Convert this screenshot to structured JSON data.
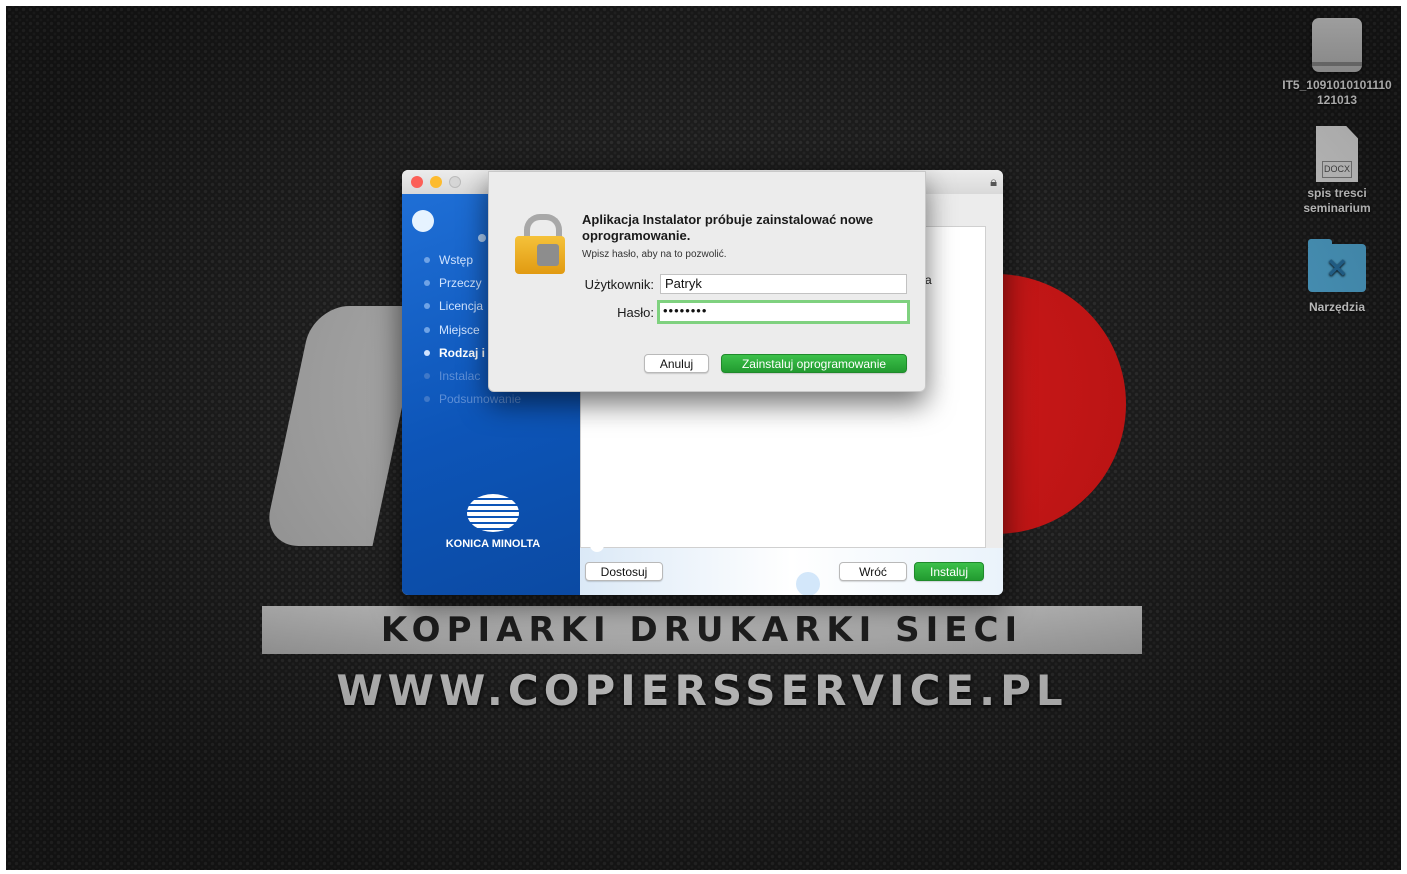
{
  "desktop": {
    "wallpaper": {
      "band_text": "KOPIARKI DRUKARKI SIECI",
      "url_text": "WWW.COPIERSSERVICE.PL"
    },
    "icons": [
      {
        "name": "IT5_1091010101110121013",
        "type": "drive-icon"
      },
      {
        "name": "spis tresci seminarium",
        "type": "docx-file-icon",
        "badge": "DOCX"
      },
      {
        "name": "Narzędzia",
        "type": "folder-icon"
      }
    ]
  },
  "installer": {
    "steps": [
      {
        "label": "Wstęp",
        "state": "done"
      },
      {
        "label": "Przeczy",
        "state": "done"
      },
      {
        "label": "Licencja",
        "state": "done"
      },
      {
        "label": "Miejsce",
        "state": "done"
      },
      {
        "label": "Rodzaj i",
        "state": "active"
      },
      {
        "label": "Instalac",
        "state": "pending"
      },
      {
        "label": "Podsumowanie",
        "state": "pending"
      }
    ],
    "brand": "KONICA MINOLTA",
    "partial_text": "a",
    "buttons": {
      "customize": "Dostosuj",
      "back": "Wróć",
      "install": "Instaluj"
    }
  },
  "auth_dialog": {
    "title": "Aplikacja Instalator próbuje zainstalować nowe oprogramowanie.",
    "subtitle": "Wpisz hasło, aby na to pozwolić.",
    "username_label": "Użytkownik:",
    "username_value": "Patryk",
    "password_label": "Hasło:",
    "password_value": "••••••••",
    "cancel_label": "Anuluj",
    "confirm_label": "Zainstaluj oprogramowanie"
  },
  "colors": {
    "accent_green": "#229b30",
    "installer_blue": "#0d55b8",
    "wallpaper_red": "#e51212"
  }
}
